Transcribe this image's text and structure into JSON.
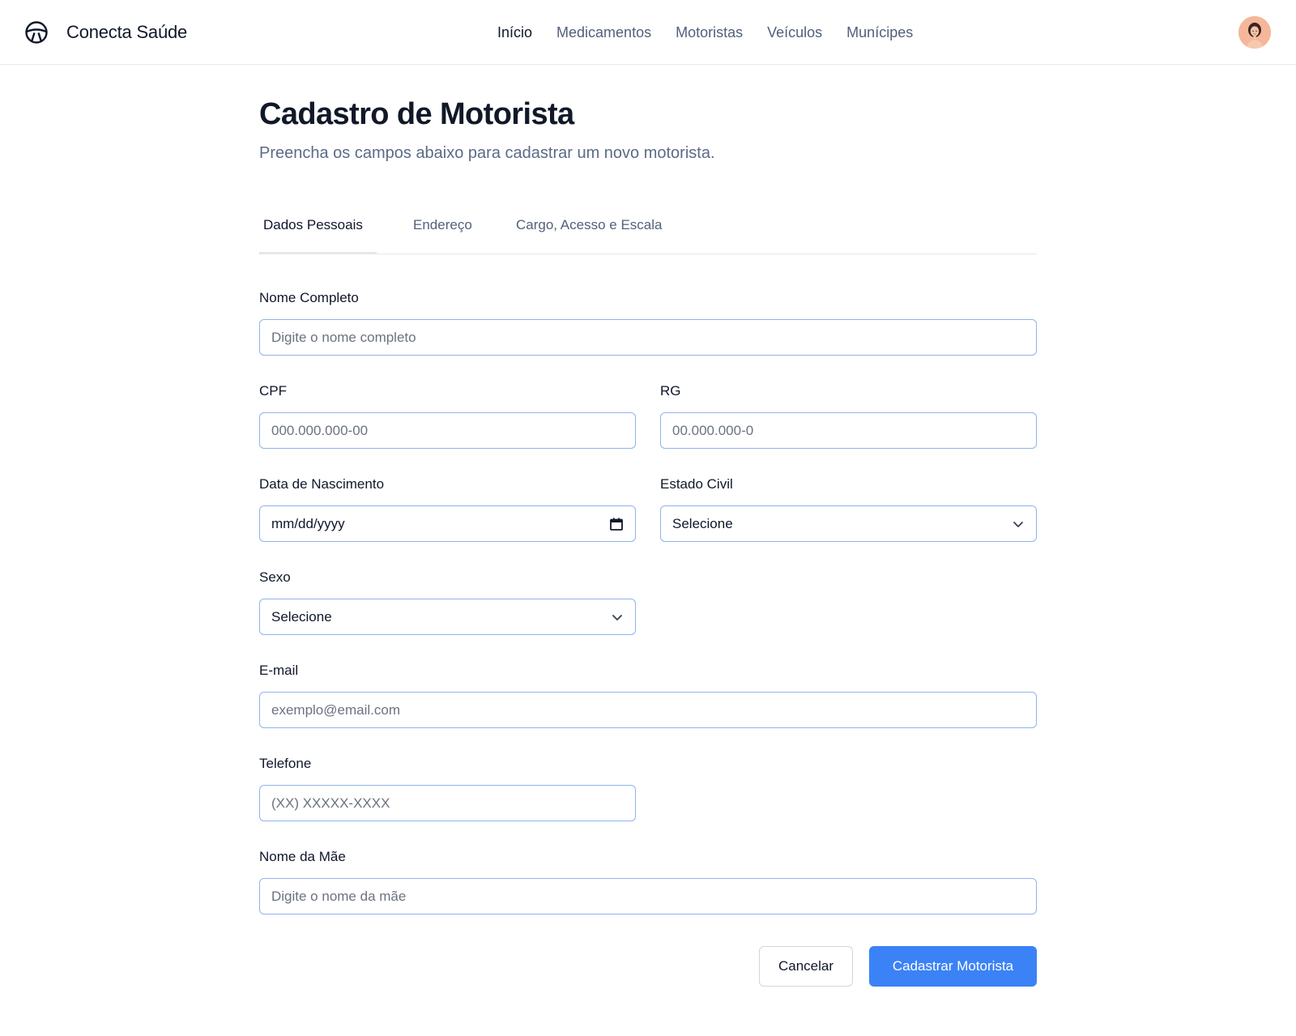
{
  "brand": {
    "name": "Conecta Saúde"
  },
  "nav": {
    "items": [
      "Início",
      "Medicamentos",
      "Motoristas",
      "Veículos",
      "Munícipes"
    ],
    "active": "Início"
  },
  "page": {
    "title": "Cadastro de Motorista",
    "subtitle": "Preencha os campos abaixo para cadastrar um novo motorista."
  },
  "tabs": [
    "Dados Pessoais",
    "Endereço",
    "Cargo, Acesso e Escala"
  ],
  "form": {
    "nome": {
      "label": "Nome Completo",
      "placeholder": "Digite o nome completo"
    },
    "cpf": {
      "label": "CPF",
      "placeholder": "000.000.000-00"
    },
    "rg": {
      "label": "RG",
      "placeholder": "00.000.000-0"
    },
    "nascimento": {
      "label": "Data de Nascimento",
      "value": "mm/dd/yyyy"
    },
    "estado_civil": {
      "label": "Estado Civil",
      "value": "Selecione"
    },
    "sexo": {
      "label": "Sexo",
      "value": "Selecione"
    },
    "email": {
      "label": "E-mail",
      "placeholder": "exemplo@email.com"
    },
    "telefone": {
      "label": "Telefone",
      "placeholder": "(XX) XXXXX-XXXX"
    },
    "mae": {
      "label": "Nome da Mãe",
      "placeholder": "Digite o nome da mãe"
    }
  },
  "actions": {
    "cancel": "Cancelar",
    "submit": "Cadastrar Motorista"
  },
  "colors": {
    "primary": "#3b82f6",
    "input_border": "#8fb3ee",
    "muted_text": "#52607a",
    "avatar_bg": "#f4b79a"
  },
  "icons": {
    "brand": "steering-wheel-icon",
    "date": "calendar-icon",
    "select": "chevron-down-icon",
    "avatar": "user-avatar"
  }
}
